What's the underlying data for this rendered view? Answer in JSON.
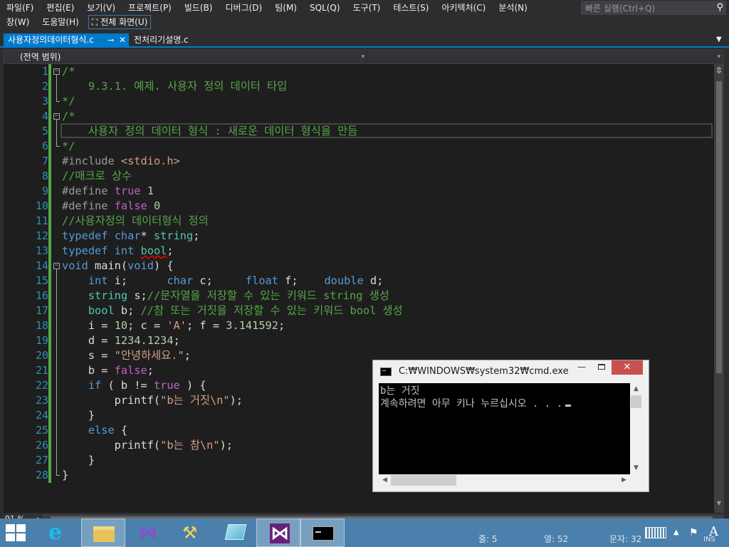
{
  "menu": {
    "row1": [
      "파일(F)",
      "편집(E)",
      "보기(V)",
      "프로젝트(P)",
      "빌드(B)",
      "디버그(D)",
      "팀(M)",
      "SQL(Q)",
      "도구(T)",
      "테스트(S)",
      "아키텍처(C)",
      "분석(N)"
    ],
    "row2": [
      "창(W)",
      "도움말(H)"
    ],
    "fullscreen_label": "전체 화면(U)"
  },
  "quick_launch": {
    "placeholder": "빠른 실행(Ctrl+Q)"
  },
  "tabs": [
    {
      "label": "사용자정의데이터형식.c",
      "active": true
    },
    {
      "label": "전처리기설명.c",
      "active": false
    }
  ],
  "nav": {
    "scope": "(전역 범위)"
  },
  "editor": {
    "zoom": "91 %",
    "lines": [
      {
        "num": "1",
        "tokens": [
          [
            "c-com",
            "/*"
          ]
        ]
      },
      {
        "num": "2",
        "tokens": [
          [
            "c-com",
            "    9.3.1. 예제. 사용자 정의 데이터 타입"
          ]
        ]
      },
      {
        "num": "3",
        "tokens": [
          [
            "c-com",
            "*/"
          ]
        ]
      },
      {
        "num": "4",
        "tokens": [
          [
            "c-com",
            "/*"
          ]
        ]
      },
      {
        "num": "5",
        "tokens": [
          [
            "c-com",
            "    사용자 정의 데이터 형식 : 새로운 데이터 형식을 만듬"
          ]
        ]
      },
      {
        "num": "6",
        "tokens": [
          [
            "c-com",
            "*/"
          ]
        ]
      },
      {
        "num": "7",
        "tokens": [
          [
            "c-pre",
            "#include "
          ],
          [
            "c-str",
            "<stdio.h>"
          ]
        ]
      },
      {
        "num": "8",
        "tokens": [
          [
            "c-com",
            "//매크로 상수"
          ]
        ]
      },
      {
        "num": "9",
        "tokens": [
          [
            "c-pre",
            "#define "
          ],
          [
            "c-mac",
            "true"
          ],
          [
            "c-def",
            " "
          ],
          [
            "c-num",
            "1"
          ]
        ]
      },
      {
        "num": "10",
        "tokens": [
          [
            "c-pre",
            "#define "
          ],
          [
            "c-mac",
            "false"
          ],
          [
            "c-def",
            " "
          ],
          [
            "c-num",
            "0"
          ]
        ]
      },
      {
        "num": "11",
        "tokens": [
          [
            "c-com",
            "//사용자정의 데이터형식 정의"
          ]
        ]
      },
      {
        "num": "12",
        "tokens": [
          [
            "c-kw",
            "typedef"
          ],
          [
            "c-def",
            " "
          ],
          [
            "c-kw",
            "char"
          ],
          [
            "c-def",
            "* "
          ],
          [
            "c-typ",
            "string"
          ],
          [
            "c-def",
            ";"
          ]
        ]
      },
      {
        "num": "13",
        "tokens": [
          [
            "c-kw",
            "typedef"
          ],
          [
            "c-def",
            " "
          ],
          [
            "c-kw",
            "int"
          ],
          [
            "c-def",
            " "
          ],
          [
            "c-typ squiggle",
            "bool"
          ],
          [
            "c-def",
            ";"
          ]
        ]
      },
      {
        "num": "14",
        "tokens": [
          [
            "c-kw",
            "void"
          ],
          [
            "c-def",
            " main("
          ],
          [
            "c-kw",
            "void"
          ],
          [
            "c-def",
            ") {"
          ]
        ]
      },
      {
        "num": "15",
        "tokens": [
          [
            "c-def",
            "    "
          ],
          [
            "c-kw",
            "int"
          ],
          [
            "c-def",
            " i;      "
          ],
          [
            "c-kw",
            "char"
          ],
          [
            "c-def",
            " c;     "
          ],
          [
            "c-kw",
            "float"
          ],
          [
            "c-def",
            " f;    "
          ],
          [
            "c-kw",
            "double"
          ],
          [
            "c-def",
            " d;"
          ]
        ]
      },
      {
        "num": "16",
        "tokens": [
          [
            "c-def",
            "    "
          ],
          [
            "c-typ",
            "string"
          ],
          [
            "c-def",
            " s;"
          ],
          [
            "c-com",
            "//문자열을 저장할 수 있는 키워드 string 생성"
          ]
        ]
      },
      {
        "num": "17",
        "tokens": [
          [
            "c-def",
            "    "
          ],
          [
            "c-typ",
            "bool"
          ],
          [
            "c-def",
            " b; "
          ],
          [
            "c-com",
            "//참 또는 거짓을 저장할 수 있는 키워드 bool 생성"
          ]
        ]
      },
      {
        "num": "18",
        "tokens": [
          [
            "c-def",
            "    i = "
          ],
          [
            "c-num",
            "10"
          ],
          [
            "c-def",
            "; c = "
          ],
          [
            "c-str",
            "'A'"
          ],
          [
            "c-def",
            "; f = "
          ],
          [
            "c-num",
            "3.141592"
          ],
          [
            "c-def",
            ";"
          ]
        ]
      },
      {
        "num": "19",
        "tokens": [
          [
            "c-def",
            "    d = "
          ],
          [
            "c-num",
            "1234.1234"
          ],
          [
            "c-def",
            ";"
          ]
        ]
      },
      {
        "num": "20",
        "tokens": [
          [
            "c-def",
            "    s = "
          ],
          [
            "c-str",
            "\"안녕하세요.\""
          ],
          [
            "c-def",
            ";"
          ]
        ]
      },
      {
        "num": "21",
        "tokens": [
          [
            "c-def",
            "    b = "
          ],
          [
            "c-mac",
            "false"
          ],
          [
            "c-def",
            ";"
          ]
        ]
      },
      {
        "num": "22",
        "tokens": [
          [
            "c-def",
            "    "
          ],
          [
            "c-kw",
            "if"
          ],
          [
            "c-def",
            " ( b != "
          ],
          [
            "c-mac",
            "true"
          ],
          [
            "c-def",
            " ) {"
          ]
        ]
      },
      {
        "num": "23",
        "tokens": [
          [
            "c-def",
            "        printf("
          ],
          [
            "c-str",
            "\"b는 거짓\\n\""
          ],
          [
            "c-def",
            ");"
          ]
        ]
      },
      {
        "num": "24",
        "tokens": [
          [
            "c-def",
            "    }"
          ]
        ]
      },
      {
        "num": "25",
        "tokens": [
          [
            "c-def",
            "    "
          ],
          [
            "c-kw",
            "else"
          ],
          [
            "c-def",
            " {"
          ]
        ]
      },
      {
        "num": "26",
        "tokens": [
          [
            "c-def",
            "        printf("
          ],
          [
            "c-str",
            "\"b는 참\\n\""
          ],
          [
            "c-def",
            ");"
          ]
        ]
      },
      {
        "num": "27",
        "tokens": [
          [
            "c-def",
            "    }"
          ]
        ]
      },
      {
        "num": "28",
        "tokens": [
          [
            "c-def",
            "}"
          ]
        ]
      }
    ]
  },
  "console": {
    "title": "C:₩WINDOWS₩system32₩cmd.exe",
    "output": [
      "b는 거짓",
      "계속하려면 아무 키나 누르십시오 . . ."
    ]
  },
  "status": {
    "line": "줄: 5",
    "col": "열: 52",
    "char": "문자: 32",
    "ins": "INS"
  }
}
